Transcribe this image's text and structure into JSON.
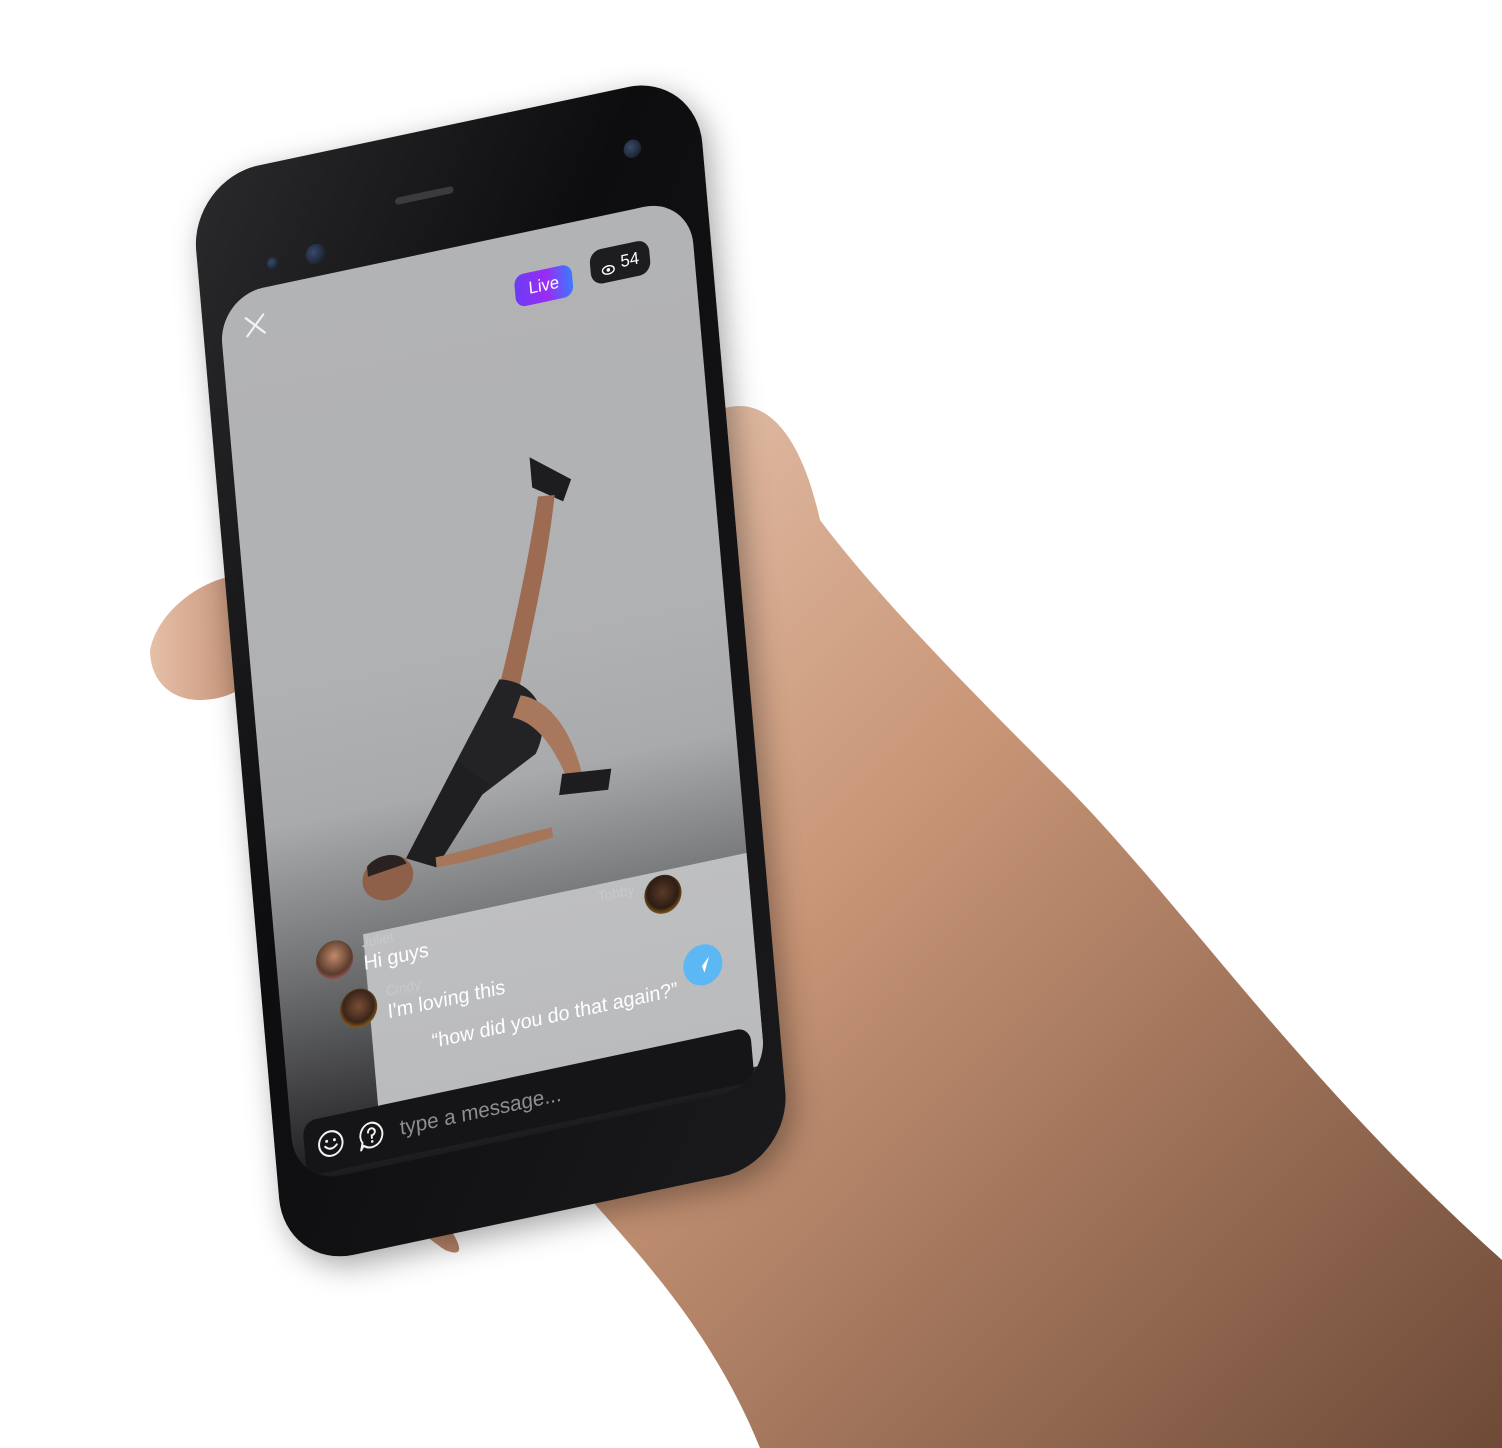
{
  "stream": {
    "live_label": "Live",
    "viewer_count": "54"
  },
  "chat": {
    "messages": [
      {
        "user": "Juliet",
        "text": "Hi guys"
      },
      {
        "user": "Cindy",
        "text": "I'm loving this"
      },
      {
        "user": "Tobby",
        "text": "“how did you do that again?”"
      }
    ]
  },
  "composer": {
    "placeholder": "type a message..."
  },
  "colors": {
    "live_gradient_start": "#6b3cf5",
    "live_gradient_end": "#3a7bff",
    "send_button": "#5bb8f5",
    "screen_top": "#b2b3b5",
    "screen_bottom": "#1c1c1e"
  },
  "icons": {
    "close": "close-icon",
    "viewers": "eye-icon",
    "emoji": "smiley-icon",
    "question": "question-bubble-icon",
    "send": "paper-plane-icon"
  }
}
